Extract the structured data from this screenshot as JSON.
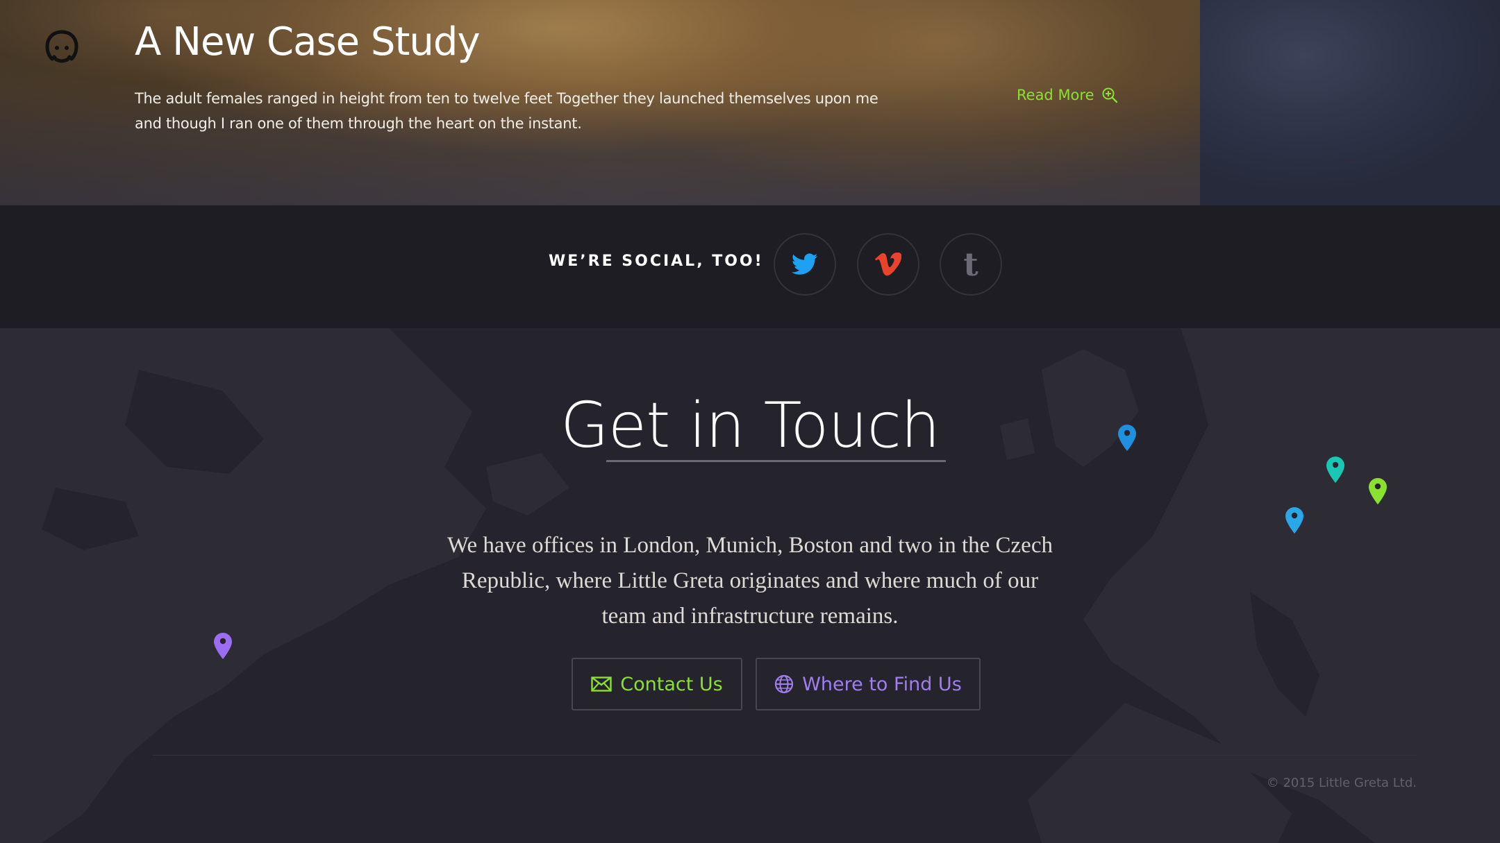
{
  "hero": {
    "title": "A New Case Study",
    "text": "The adult females ranged in height from ten to twelve feet Together they launched themselves upon me and though I ran one of them through the heart on the instant.",
    "read_more": "Read More"
  },
  "social": {
    "label": "WE’RE SOCIAL, TOO!",
    "links": [
      {
        "name": "twitter",
        "icon": "twitter-icon",
        "color": "#1da1f2"
      },
      {
        "name": "vimeo",
        "icon": "vimeo-icon",
        "color": "#e8432b"
      },
      {
        "name": "tumblr",
        "icon": "tumblr-icon",
        "color": "#6c6b75",
        "glyph": "t"
      }
    ]
  },
  "contact": {
    "title": "Get in Touch",
    "text": "We have offices in London, Munich, Boston and two in the Czech Republic, where Little Greta originates and where much of our team and infrastructure remains.",
    "buttons": {
      "contact_us": "Contact Us",
      "where_to_find_us": "Where to Find Us"
    },
    "pins": [
      {
        "city": "London",
        "color": "#1f8fe0"
      },
      {
        "city": "Czech Republic",
        "color": "#18c7b4"
      },
      {
        "city": "Czech Republic",
        "color": "#8be12f"
      },
      {
        "city": "Munich",
        "color": "#29a7e8"
      },
      {
        "city": "Boston",
        "color": "#9b6df0"
      }
    ]
  },
  "footer": {
    "copyright": "© 2015 Little Greta Ltd."
  },
  "colors": {
    "accent_green": "#8be12f",
    "accent_purple": "#9f7ef0",
    "background": "#24232b",
    "social_bar": "#1e1d24"
  }
}
